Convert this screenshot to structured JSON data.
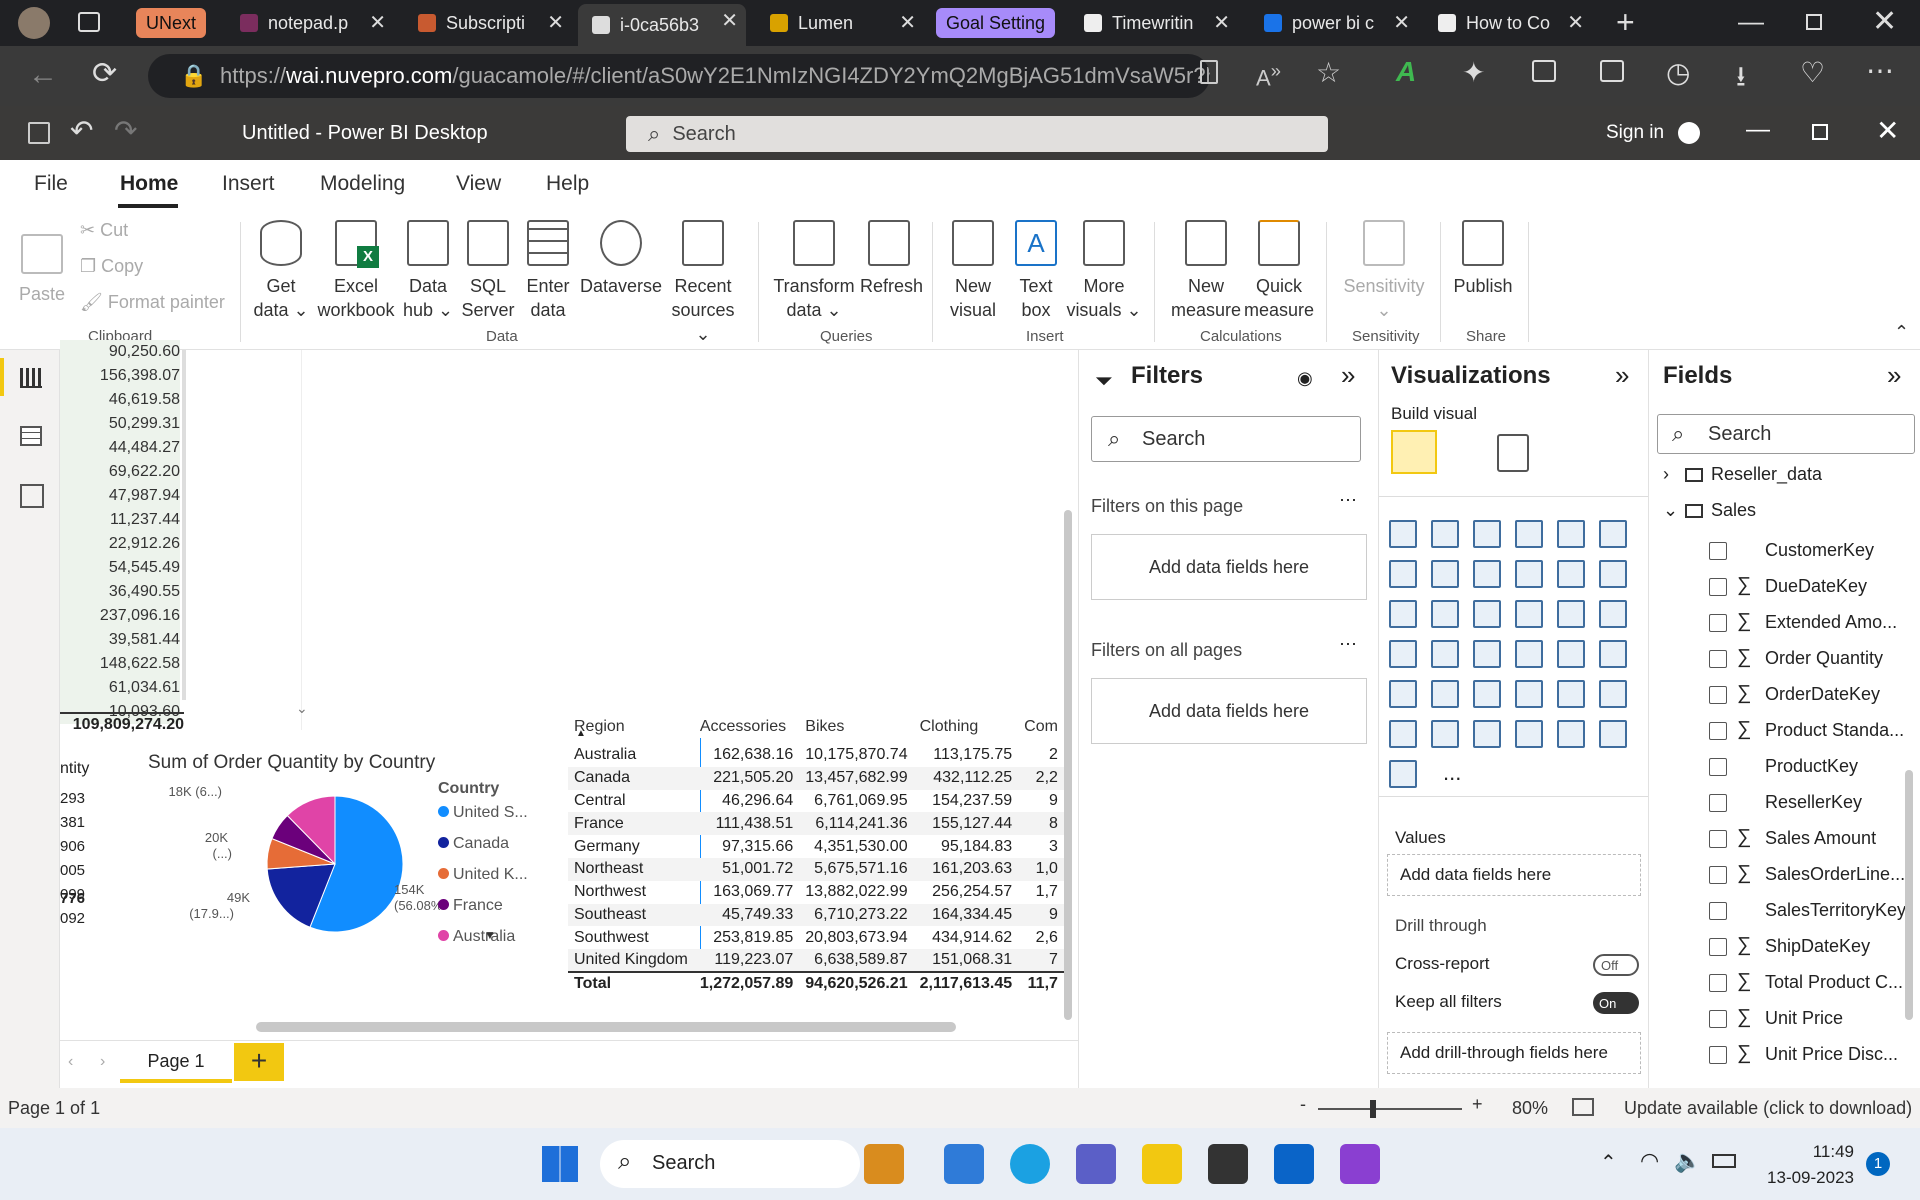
{
  "browser": {
    "tabs": [
      {
        "label": "UNext",
        "kind": "group"
      },
      {
        "label": "notepad.p"
      },
      {
        "label": "Subscripti"
      },
      {
        "label": "i-0ca56b3",
        "active": true
      },
      {
        "label": "Lumen"
      },
      {
        "label": "Goal Setting",
        "kind": "group"
      },
      {
        "label": "Timewritin"
      },
      {
        "label": "power bi c"
      },
      {
        "label": "How to Co"
      }
    ],
    "url_prefix": "https://",
    "url_host": "wai.nuvepro.com",
    "url_path": "/guacamole/#/client/aS0wY2E1NmIzNGI4ZDY2YmQ2MgBjAG51dmVsaW5r?h..."
  },
  "app": {
    "title": "Untitled - Power BI Desktop",
    "search_placeholder": "Search",
    "sign_in": "Sign in"
  },
  "menu": [
    "File",
    "Home",
    "Insert",
    "Modeling",
    "View",
    "Help"
  ],
  "ribbon": {
    "clipboard": {
      "paste": "Paste",
      "cut": "Cut",
      "copy": "Copy",
      "format_painter": "Format painter",
      "group": "Clipboard"
    },
    "data": {
      "get_data": [
        "Get",
        "data ⌄"
      ],
      "excel": [
        "Excel",
        "workbook"
      ],
      "data_hub": [
        "Data",
        "hub ⌄"
      ],
      "sql": [
        "SQL",
        "Server"
      ],
      "enter": [
        "Enter",
        "data"
      ],
      "dataverse": [
        "Dataverse",
        ""
      ],
      "recent": [
        "Recent",
        "sources ⌄"
      ],
      "group": "Data"
    },
    "queries": {
      "transform": [
        "Transform",
        "data ⌄"
      ],
      "refresh": [
        "Refresh",
        ""
      ],
      "group": "Queries"
    },
    "insert": {
      "new_visual": [
        "New",
        "visual"
      ],
      "text_box": [
        "Text",
        "box"
      ],
      "more_visuals": [
        "More",
        "visuals ⌄"
      ],
      "group": "Insert"
    },
    "calculations": {
      "new_measure": [
        "New",
        "measure"
      ],
      "quick_measure": [
        "Quick",
        "measure"
      ],
      "group": "Calculations"
    },
    "sensitivity": {
      "label": [
        "Sensitivity",
        "⌄"
      ],
      "group": "Sensitivity"
    },
    "share": {
      "publish": [
        "Publish",
        ""
      ],
      "group": "Share"
    }
  },
  "canvas": {
    "column_values": [
      "90,250.60",
      "156,398.07",
      "46,619.58",
      "50,299.31",
      "44,484.27",
      "69,622.20",
      "47,987.94",
      "11,237.44",
      "22,912.26",
      "54,545.49",
      "36,490.55",
      "237,096.16",
      "39,581.44",
      "148,622.58",
      "61,034.61",
      "10,093.60"
    ],
    "column_total": "109,809,274.20",
    "partial_header": "ntity",
    "partial_values": [
      "293",
      "381",
      "906",
      "005",
      "099",
      "092"
    ],
    "partial_total": "776",
    "page_tab": "Page 1"
  },
  "chart_data": {
    "type": "pie",
    "title": "Sum of Order Quantity by Country",
    "legend_title": "Country",
    "legend_placement": "right",
    "categories": [
      "United S...",
      "Canada",
      "United K...",
      "France",
      "Australia"
    ],
    "values": [
      154000,
      49000,
      20000,
      18000,
      34000
    ],
    "colors": [
      "#118dff",
      "#12239e",
      "#e66c37",
      "#6b007b",
      "#e044a7"
    ],
    "data_labels": [
      "154K",
      "(56.08%)",
      "49K",
      "(17.9...)",
      "20K",
      "(...)",
      "18K (6...)"
    ]
  },
  "matrix": {
    "headers": [
      "Region",
      "Accessories",
      "Bikes",
      "Clothing",
      "Com"
    ],
    "rows": [
      [
        "Australia",
        "162,638.16",
        "10,175,870.74",
        "113,175.75",
        "2"
      ],
      [
        "Canada",
        "221,505.20",
        "13,457,682.99",
        "432,112.25",
        "2,2"
      ],
      [
        "Central",
        "46,296.64",
        "6,761,069.95",
        "154,237.59",
        "9"
      ],
      [
        "France",
        "111,438.51",
        "6,114,241.36",
        "155,127.44",
        "8"
      ],
      [
        "Germany",
        "97,315.66",
        "4,351,530.00",
        "95,184.83",
        "3"
      ],
      [
        "Northeast",
        "51,001.72",
        "5,675,571.16",
        "161,203.63",
        "1,0"
      ],
      [
        "Northwest",
        "163,069.77",
        "13,882,022.99",
        "256,254.57",
        "1,7"
      ],
      [
        "Southeast",
        "45,749.33",
        "6,710,273.22",
        "164,334.45",
        "9"
      ],
      [
        "Southwest",
        "253,819.85",
        "20,803,673.94",
        "434,914.62",
        "2,6"
      ],
      [
        "United Kingdom",
        "119,223.07",
        "6,638,589.87",
        "151,068.31",
        "7"
      ]
    ],
    "total": [
      "Total",
      "1,272,057.89",
      "94,620,526.21",
      "2,117,613.45",
      "11,7"
    ]
  },
  "filters": {
    "title": "Filters",
    "search": "Search",
    "on_page": "Filters on this page",
    "on_all": "Filters on all pages",
    "add": "Add data fields here"
  },
  "visualizations": {
    "title": "Visualizations",
    "build": "Build visual",
    "values": "Values",
    "values_add": "Add data fields here",
    "drill": "Drill through",
    "cross_report": "Cross-report",
    "cross_report_state": "Off",
    "keep_filters": "Keep all filters",
    "keep_filters_state": "On",
    "drill_add": "Add drill-through fields here",
    "more": "..."
  },
  "fields": {
    "title": "Fields",
    "search": "Search",
    "tables": [
      "Reseller_data",
      "Sales"
    ],
    "items": [
      {
        "label": "CustomerKey",
        "sigma": false
      },
      {
        "label": "DueDateKey",
        "sigma": true
      },
      {
        "label": "Extended Amo...",
        "sigma": true
      },
      {
        "label": "Order Quantity",
        "sigma": true
      },
      {
        "label": "OrderDateKey",
        "sigma": true
      },
      {
        "label": "Product Standa...",
        "sigma": true
      },
      {
        "label": "ProductKey",
        "sigma": false
      },
      {
        "label": "ResellerKey",
        "sigma": false
      },
      {
        "label": "Sales Amount",
        "sigma": true
      },
      {
        "label": "SalesOrderLine...",
        "sigma": true
      },
      {
        "label": "SalesTerritoryKey",
        "sigma": false
      },
      {
        "label": "ShipDateKey",
        "sigma": true
      },
      {
        "label": "Total Product C...",
        "sigma": true
      },
      {
        "label": "Unit Price",
        "sigma": true
      },
      {
        "label": "Unit Price Disc...",
        "sigma": true
      }
    ]
  },
  "status": {
    "page": "Page 1 of 1",
    "zoom": "80%",
    "update": "Update available (click to download)"
  },
  "taskbar": {
    "search": "Search",
    "time": "11:49",
    "date": "13-09-2023",
    "badge": "1"
  }
}
